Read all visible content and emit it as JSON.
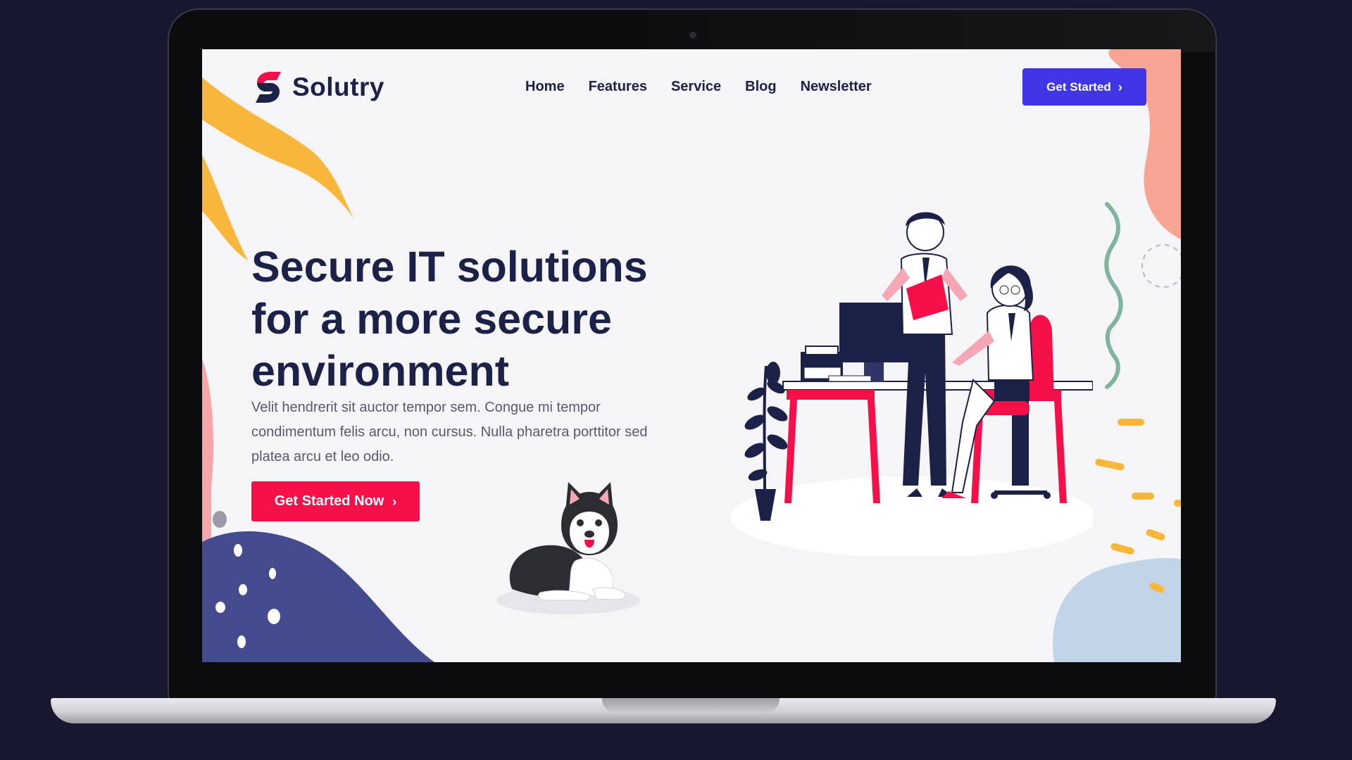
{
  "brand": {
    "name": "Solutry",
    "logo_icon": "solutry-logo-icon",
    "colors": {
      "red": "#f5104a",
      "navy": "#1c2148",
      "purple": "#4136e6"
    }
  },
  "nav": {
    "items": [
      {
        "label": "Home"
      },
      {
        "label": "Features"
      },
      {
        "label": "Service"
      },
      {
        "label": "Blog"
      },
      {
        "label": "Newsletter"
      }
    ],
    "cta_label": "Get Started",
    "cta_icon": "chevron-right-icon"
  },
  "hero": {
    "title": "Secure IT solutions for a more secure environment",
    "description": "Velit hendrerit sit auctor tempor sem. Congue mi tempor condimentum felis arcu, non cursus. Nulla pharetra porttitor sed platea arcu et leo odio.",
    "cta_label": "Get Started Now",
    "cta_icon": "chevron-right-icon"
  },
  "illustrations": {
    "office": "office-workers-illustration",
    "dog": "husky-dog-illustration"
  }
}
